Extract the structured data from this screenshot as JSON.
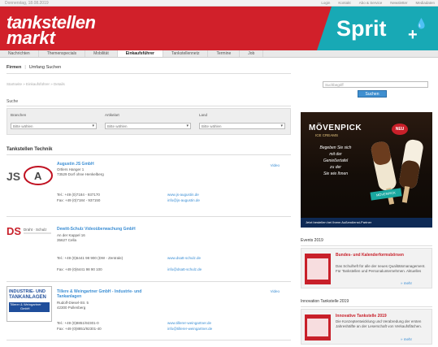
{
  "topbar": {
    "date": "Donnerstag, 18.08.2019",
    "links": [
      "Login",
      "Kontakt",
      "Abo & Service",
      "Newsletter",
      "Mediadaten"
    ]
  },
  "brand": {
    "logo_line1": "tankstellen",
    "logo_line2": "markt",
    "sprit": "Sprit",
    "sprit_plus": "+",
    "colors": {
      "red": "#d1202a",
      "teal": "#18a9b5",
      "link": "#3b8ed4"
    }
  },
  "nav": {
    "items": [
      "Nachrichten",
      "Themenspecials",
      "Mobilität",
      "Einkaufsführer",
      "Tankstellennetz",
      "Termine",
      "Job"
    ],
    "active_index": 3
  },
  "subnav": {
    "firmen": "Firmen",
    "separator": "|",
    "umfang": "Umfang Suchen"
  },
  "breadcrumb": "Startseite » Einkaufsführer » Details",
  "search": {
    "placeholder": "Suchbegriff",
    "button": "Suchen"
  },
  "filter": {
    "title": "Suche",
    "labels": [
      "Branchen",
      "Artikelart",
      "Land"
    ],
    "values": [
      "Bitte wählen",
      "Bitte wählen",
      "Bitte wählen"
    ]
  },
  "list": {
    "title": "Tankstellen Technik",
    "entries": [
      {
        "name": "Augustin JS GmbH",
        "address": [
          "Ortlers Hanger 1",
          "73529 Dorf ohne Henkelberg"
        ],
        "tel": "Tel.: +49 (0)7184 - 937170",
        "fax": "Fax: +49 (0)7184 - 937150",
        "web": "www.js-augustin.de",
        "mail": "info@js-augustin.de",
        "mark": "Video",
        "logo_text": "JSA"
      },
      {
        "name": "Dewitt-Schulz Videoüberwachung GmbH",
        "address": [
          "An der Kappel 16",
          "35627 Cella"
        ],
        "tel": "Tel.: +49 (0)6441 98 900 (DW - Zentrale)",
        "fax": "Fax: +49 (0)6441 98 90 100",
        "web": "www.dsatt-schulz.de",
        "mail": "info@dsatt-schulz.de",
        "mark": "",
        "logo_text": "DS Draht · Schulz"
      },
      {
        "name": "Tillere & Weingartner GmbH - Industrie- und Tankanlagen",
        "address": [
          "Rudolf-Diesel-Str. 5",
          "42300 Pullenberg"
        ],
        "tel": "Tel.: +49 (0)8851/92301-0",
        "fax": "Fax: +49 (0)8851/92301-40",
        "web": "www.tillerer-weingartner.de",
        "mail": "info@tillerer-weingartner.de",
        "mark": "Video",
        "logo_text": [
          "INDUSTRIE- UND",
          "TANKANLAGEN",
          "Tillerer & Weingartner",
          "GmbH"
        ]
      }
    ]
  },
  "ad": {
    "brand": "MÖVENPICK",
    "subbrand": "ICE CREAMS",
    "tagline": [
      "Begeben Sie sich",
      "mit der",
      "Genießertafel",
      "zu der",
      "Sie wie Ihnen"
    ],
    "badge": "NEU",
    "footer": "Jetzt bestellen bei Ihrem Außendienst-Partner"
  },
  "sidebar": {
    "sections": [
      {
        "title": "Events 2019",
        "item_title": "Bundes- und Kalenderformsbörsen",
        "item_desc": "Das Schulheft für alle der neues Qualitätsmanagement. Für Tankstellen und Personalunternehmen. Aktuelles",
        "link": "» mehr"
      },
      {
        "title": "Innovation Tankstelle 2019",
        "item_title": "Innovative Tankstelle 2019",
        "item_desc": "Die Konzeptentwicklung und Verabredung der ersten Jahreshälfte an der Leserschaft von Verkaufsflächen.",
        "link": "» mehr"
      }
    ]
  }
}
